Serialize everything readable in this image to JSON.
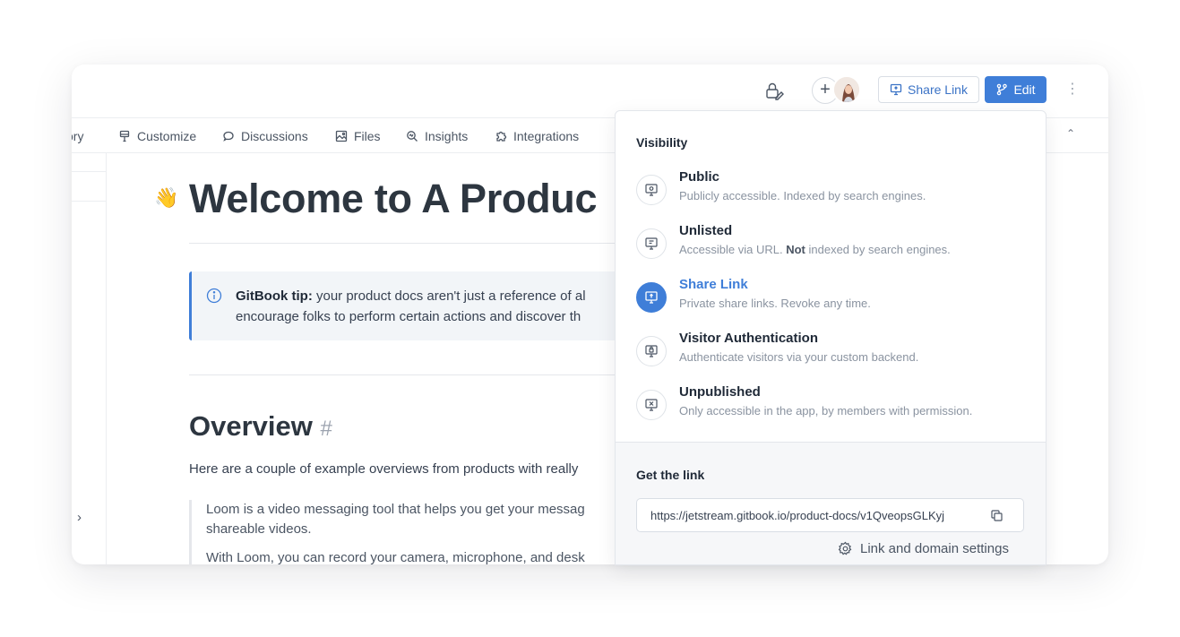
{
  "tabs": [
    {
      "label": "ory",
      "icon": "history-icon"
    },
    {
      "label": "Customize",
      "icon": "brush-icon"
    },
    {
      "label": "Discussions",
      "icon": "chat-bubble-icon"
    },
    {
      "label": "Files",
      "icon": "image-icon"
    },
    {
      "label": "Insights",
      "icon": "insights-icon"
    },
    {
      "label": "Integrations",
      "icon": "puzzle-icon"
    }
  ],
  "toolbar": {
    "share_label": "Share Link",
    "edit_label": "Edit",
    "more_icon": "kebab-menu-icon"
  },
  "page": {
    "title": "Welcome to A Produc",
    "hint_bold": "GitBook tip:",
    "hint_line1": " your product docs aren't just a reference of al",
    "hint_line2": "encourage folks to perform certain actions and discover th",
    "overview_heading": "Overview",
    "overview_hash": "#",
    "overview_text": "Here are a couple of example overviews from products with really",
    "quote_line1": "Loom is a video messaging tool that helps you get your messag",
    "quote_line2": "shareable videos.",
    "quote_line3": "With Loom, you can record your camera, microphone, and desk"
  },
  "visibility": {
    "heading": "Visibility",
    "options": [
      {
        "title": "Public",
        "desc": "Publicly accessible. Indexed by search engines.",
        "active": false
      },
      {
        "title": "Unlisted",
        "desc_before": "Accessible via URL. ",
        "desc_bold": "Not",
        "desc_after": " indexed by search engines.",
        "active": false
      },
      {
        "title": "Share Link",
        "desc": "Private share links. Revoke any time.",
        "active": true
      },
      {
        "title": "Visitor Authentication",
        "desc": "Authenticate visitors via your custom backend.",
        "active": false
      },
      {
        "title": "Unpublished",
        "desc": "Only accessible in the app, by members with permission.",
        "active": false
      }
    ]
  },
  "link": {
    "heading": "Get the link",
    "url": "https://jetstream.gitbook.io/product-docs/v1QveopsGLKyj",
    "settings_label": "Link and domain settings"
  },
  "colors": {
    "accent": "#3f7ed8",
    "text": "#1f2937",
    "muted": "#8a93a0"
  }
}
